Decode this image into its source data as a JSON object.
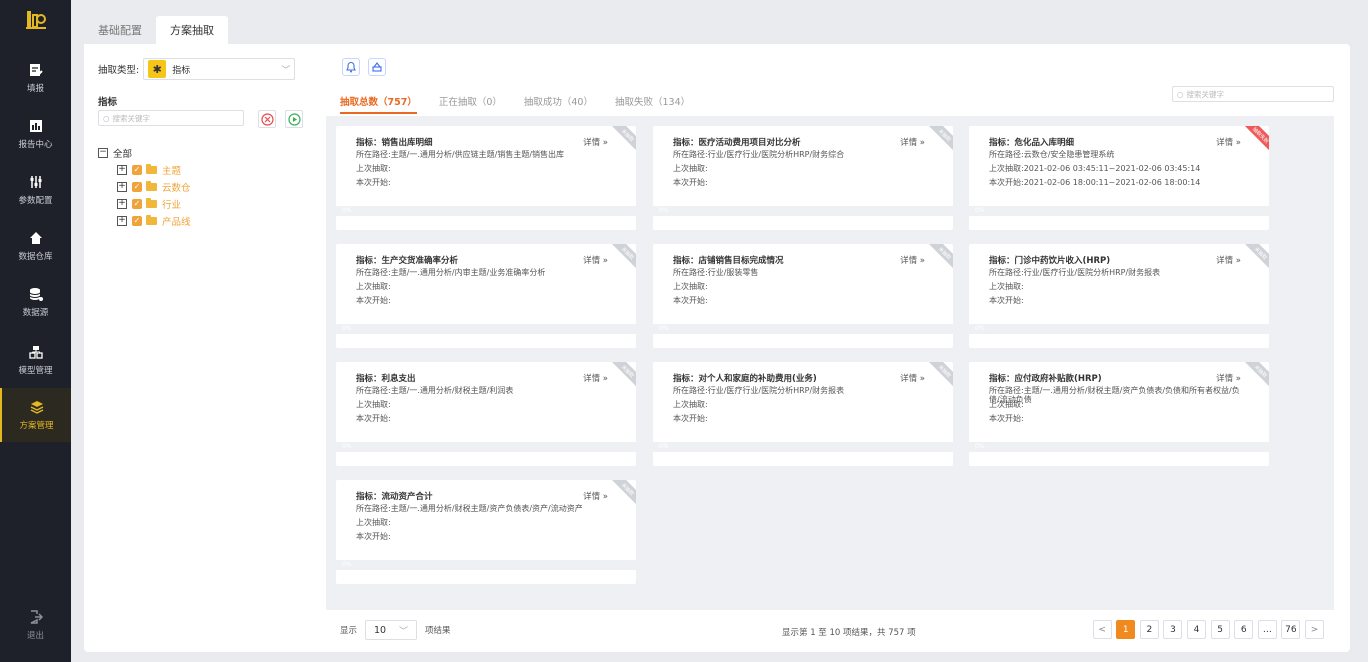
{
  "sidebar": {
    "items": [
      {
        "label": "填报",
        "icon": "edit-icon"
      },
      {
        "label": "报告中心",
        "icon": "report-icon"
      },
      {
        "label": "参数配置",
        "icon": "sliders-icon"
      },
      {
        "label": "数据仓库",
        "icon": "home-icon"
      },
      {
        "label": "数据源",
        "icon": "database-icon"
      },
      {
        "label": "模型管理",
        "icon": "model-icon"
      },
      {
        "label": "方案管理",
        "icon": "layers-icon"
      }
    ],
    "logout": "退出"
  },
  "tabs": [
    "基础配置",
    "方案抽取"
  ],
  "left": {
    "type_label": "抽取类型:",
    "type_value": "指标",
    "section_title": "指标",
    "search_placeholder": "搜索关键字",
    "tree": {
      "root": "全部",
      "children": [
        "主题",
        "云数仓",
        "行业",
        "产品线"
      ]
    }
  },
  "right": {
    "status_tabs": [
      "抽取总数（757）",
      "正在抽取（0）",
      "抽取成功（40）",
      "抽取失败（134）"
    ],
    "search_placeholder": "搜索关键字",
    "detail_label": "详情 »",
    "progress_label": "0%",
    "cards": [
      {
        "title": "指标：销售出库明细",
        "path": "所在路径:主题/一.通用分析/供应链主题/销售主题/销售出库",
        "last": "上次抽取:",
        "start": "本次开始:",
        "status": "未抽取"
      },
      {
        "title": "指标：医疗活动费用项目对比分析",
        "path": "所在路径:行业/医疗行业/医院分析HRP/财务综合",
        "last": "上次抽取:",
        "start": "本次开始:",
        "status": "未抽取"
      },
      {
        "title": "指标：危化品入库明细",
        "path": "所在路径:云数仓/安全隐患管理系统",
        "last": "上次抽取:2021-02-06 03:45:11~2021-02-06 03:45:14",
        "start": "本次开始:2021-02-06 18:00:11~2021-02-06 18:00:14",
        "status": "抽取失败"
      },
      {
        "title": "指标：生产交货准确率分析",
        "path": "所在路径:主题/一.通用分析/内审主题/业务准确率分析",
        "last": "上次抽取:",
        "start": "本次开始:",
        "status": "未抽取"
      },
      {
        "title": "指标：店铺销售目标完成情况",
        "path": "所在路径:行业/服装零售",
        "last": "上次抽取:",
        "start": "本次开始:",
        "status": "未抽取"
      },
      {
        "title": "指标：门诊中药饮片收入(HRP)",
        "path": "所在路径:行业/医疗行业/医院分析HRP/财务报表",
        "last": "上次抽取:",
        "start": "本次开始:",
        "status": "未抽取"
      },
      {
        "title": "指标：利息支出",
        "path": "所在路径:主题/一.通用分析/财税主题/利润表",
        "last": "上次抽取:",
        "start": "本次开始:",
        "status": "未抽取"
      },
      {
        "title": "指标：对个人和家庭的补助费用(业务)",
        "path": "所在路径:行业/医疗行业/医院分析HRP/财务报表",
        "last": "上次抽取:",
        "start": "本次开始:",
        "status": "未抽取"
      },
      {
        "title": "指标：应付政府补贴款(HRP)",
        "path": "所在路径:主题/一.通用分析/财税主题/资产负债表/负债和所有者权益/负债/流动负债",
        "last": "上次抽取:",
        "start": "本次开始:",
        "status": "未抽取"
      },
      {
        "title": "指标：流动资产合计",
        "path": "所在路径:主题/一.通用分析/财税主题/资产负债表/资产/流动资产",
        "last": "上次抽取:",
        "start": "本次开始:",
        "status": "未抽取"
      }
    ]
  },
  "footer": {
    "show_label": "显示",
    "page_size": "10",
    "page_size_suffix": "项结果",
    "info": "显示第 1 至 10 项结果，共 757 项",
    "pages": [
      "1",
      "2",
      "3",
      "4",
      "5",
      "6",
      "…",
      "76"
    ],
    "prev": "<",
    "next": ">"
  },
  "colors": {
    "accent": "#e86a22",
    "sidebar_bg": "#1e2129",
    "active_nav": "#e4b821",
    "failed_ribbon": "#ee5a5a"
  }
}
